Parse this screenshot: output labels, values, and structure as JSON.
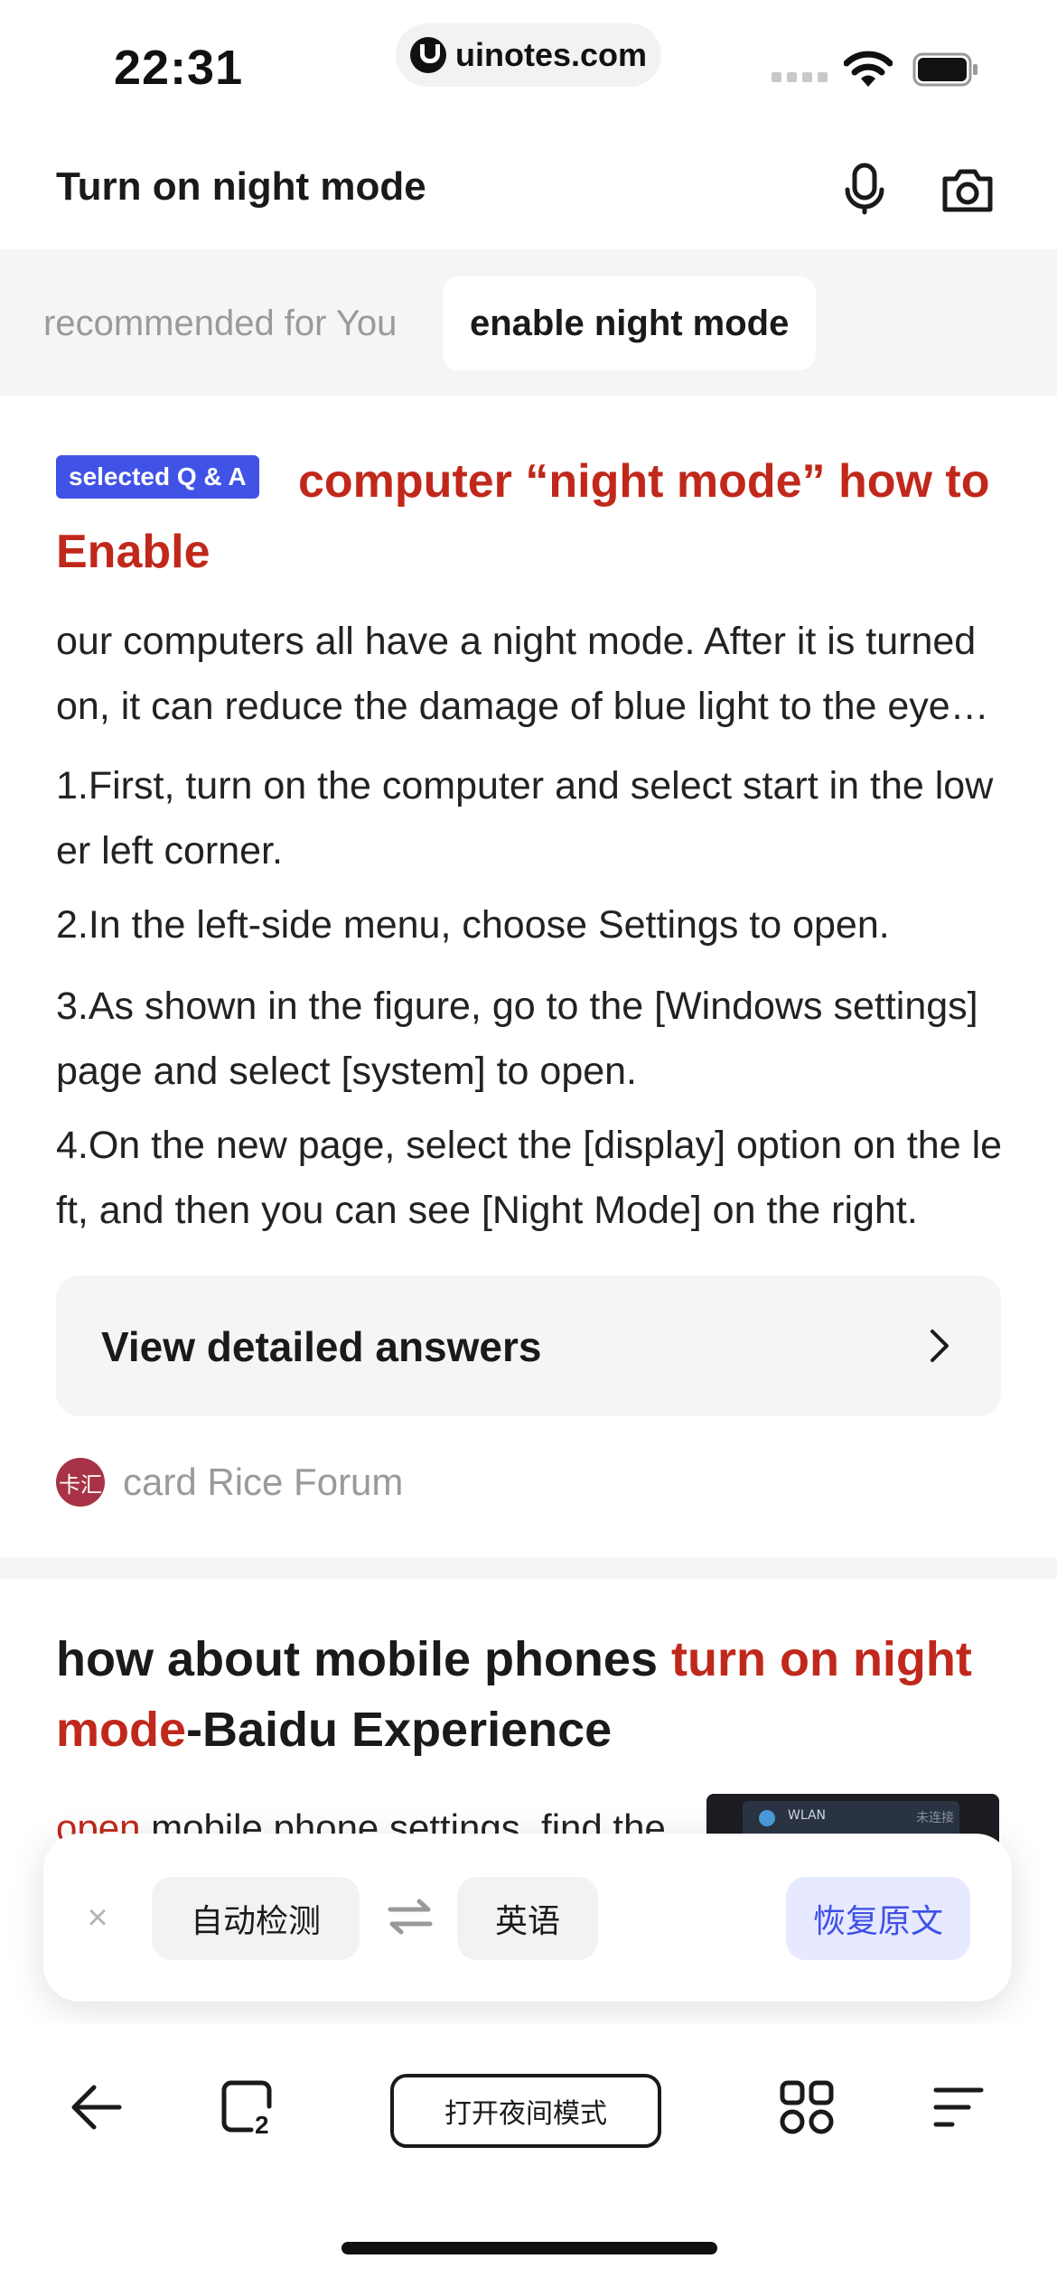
{
  "status_bar": {
    "time": "22:31",
    "url": "uinotes.com",
    "icons": [
      "site-logo-icon",
      "cellular-signal-icon",
      "wifi-icon",
      "battery-icon"
    ]
  },
  "search_bar": {
    "query": "Turn on night mode",
    "icons": [
      "microphone-icon",
      "camera-icon"
    ]
  },
  "tabs": [
    {
      "label": "recommended for You",
      "active": false
    },
    {
      "label": "enable night mode",
      "active": true
    }
  ],
  "card1": {
    "badge": "selected Q & A",
    "title": "computer “night mode” how to Enable",
    "snippets": [
      "our computers all have a night mode. After it is turned on, it can reduce the damage of blue light to the eyes and protect eyesight.",
      "1.First, turn on the computer and select start in the lower left corner.",
      "2.In the left-side menu, choose Settings to open.",
      "3.As shown in the figure, go to the [Windows settings] page and select [system] to open.",
      "4.On the new page, select the [display] option on the left, and then you can see [Night Mode] on the right."
    ],
    "view_answers_label": "View detailed answers",
    "source_logo_text": "卡汇",
    "source_name": "card Rice Forum"
  },
  "card2": {
    "title_prefix": "how about mobile phones ",
    "title_highlight": "turn on night mode",
    "title_suffix": "-Baidu Experience",
    "snippet_highlight": "open",
    "snippet_rest": " mobile phone settings, find the",
    "thumbnail_label": "WLAN",
    "thumbnail_right_text": "未连接"
  },
  "translate_bar": {
    "close_symbol": "×",
    "source_lang": "自动检测",
    "target_lang": "英语",
    "restore_label": "恢复原文"
  },
  "toolbar": {
    "query_label": "打开夜间模式",
    "tab_count": "2",
    "icons": [
      "back-arrow-icon",
      "tabs-icon",
      "grid-icon",
      "menu-icon"
    ]
  },
  "colors": {
    "accent_red": "#c0281b",
    "badge_blue": "#4153e6",
    "restore_bg": "#e6e9ff",
    "restore_text": "#3f4fe8"
  }
}
